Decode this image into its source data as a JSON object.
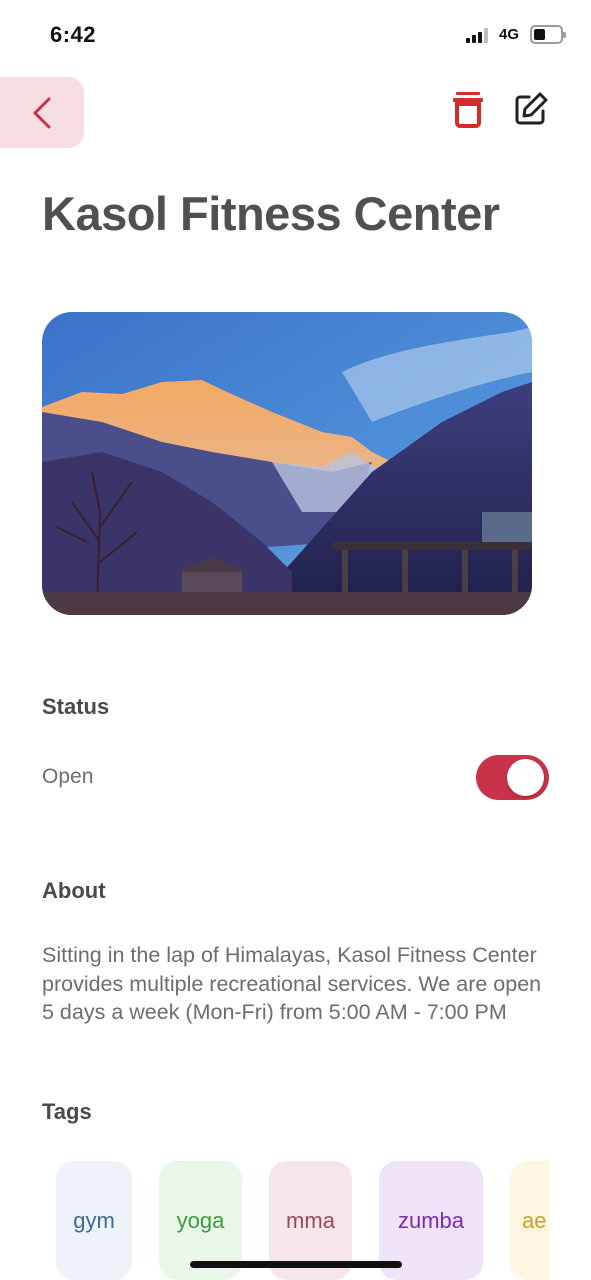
{
  "status_bar": {
    "time": "6:42",
    "network": "4G"
  },
  "header": {
    "back_icon": "chevron-left-icon",
    "delete_icon": "trash-icon",
    "edit_icon": "edit-icon",
    "accent_color": "#c8334a"
  },
  "title": "Kasol Fitness Center",
  "hero_image": {
    "description_icon": "mountain-photo"
  },
  "status": {
    "label": "Status",
    "value": "Open",
    "toggle_on": true
  },
  "about": {
    "label": "About",
    "text": "Sitting in the lap of Himalayas, Kasol Fitness Center provides multiple recreational services. We are open 5 days a week (Mon-Fri) from 5:00 AM - 7:00 PM"
  },
  "tags": {
    "label": "Tags",
    "items": [
      {
        "label": "gym",
        "bg": "#eef3f9",
        "color": "#3d6a99"
      },
      {
        "label": "yoga",
        "bg": "#e9f7e9",
        "color": "#3d9a3d"
      },
      {
        "label": "mma",
        "bg": "#f7e6e9",
        "color": "#9a4a56"
      },
      {
        "label": "zumba",
        "bg": "#efe3f8",
        "color": "#7a2ea8"
      },
      {
        "label": "ae",
        "bg": "#fdf6e3",
        "color": "#c9a227"
      }
    ]
  }
}
